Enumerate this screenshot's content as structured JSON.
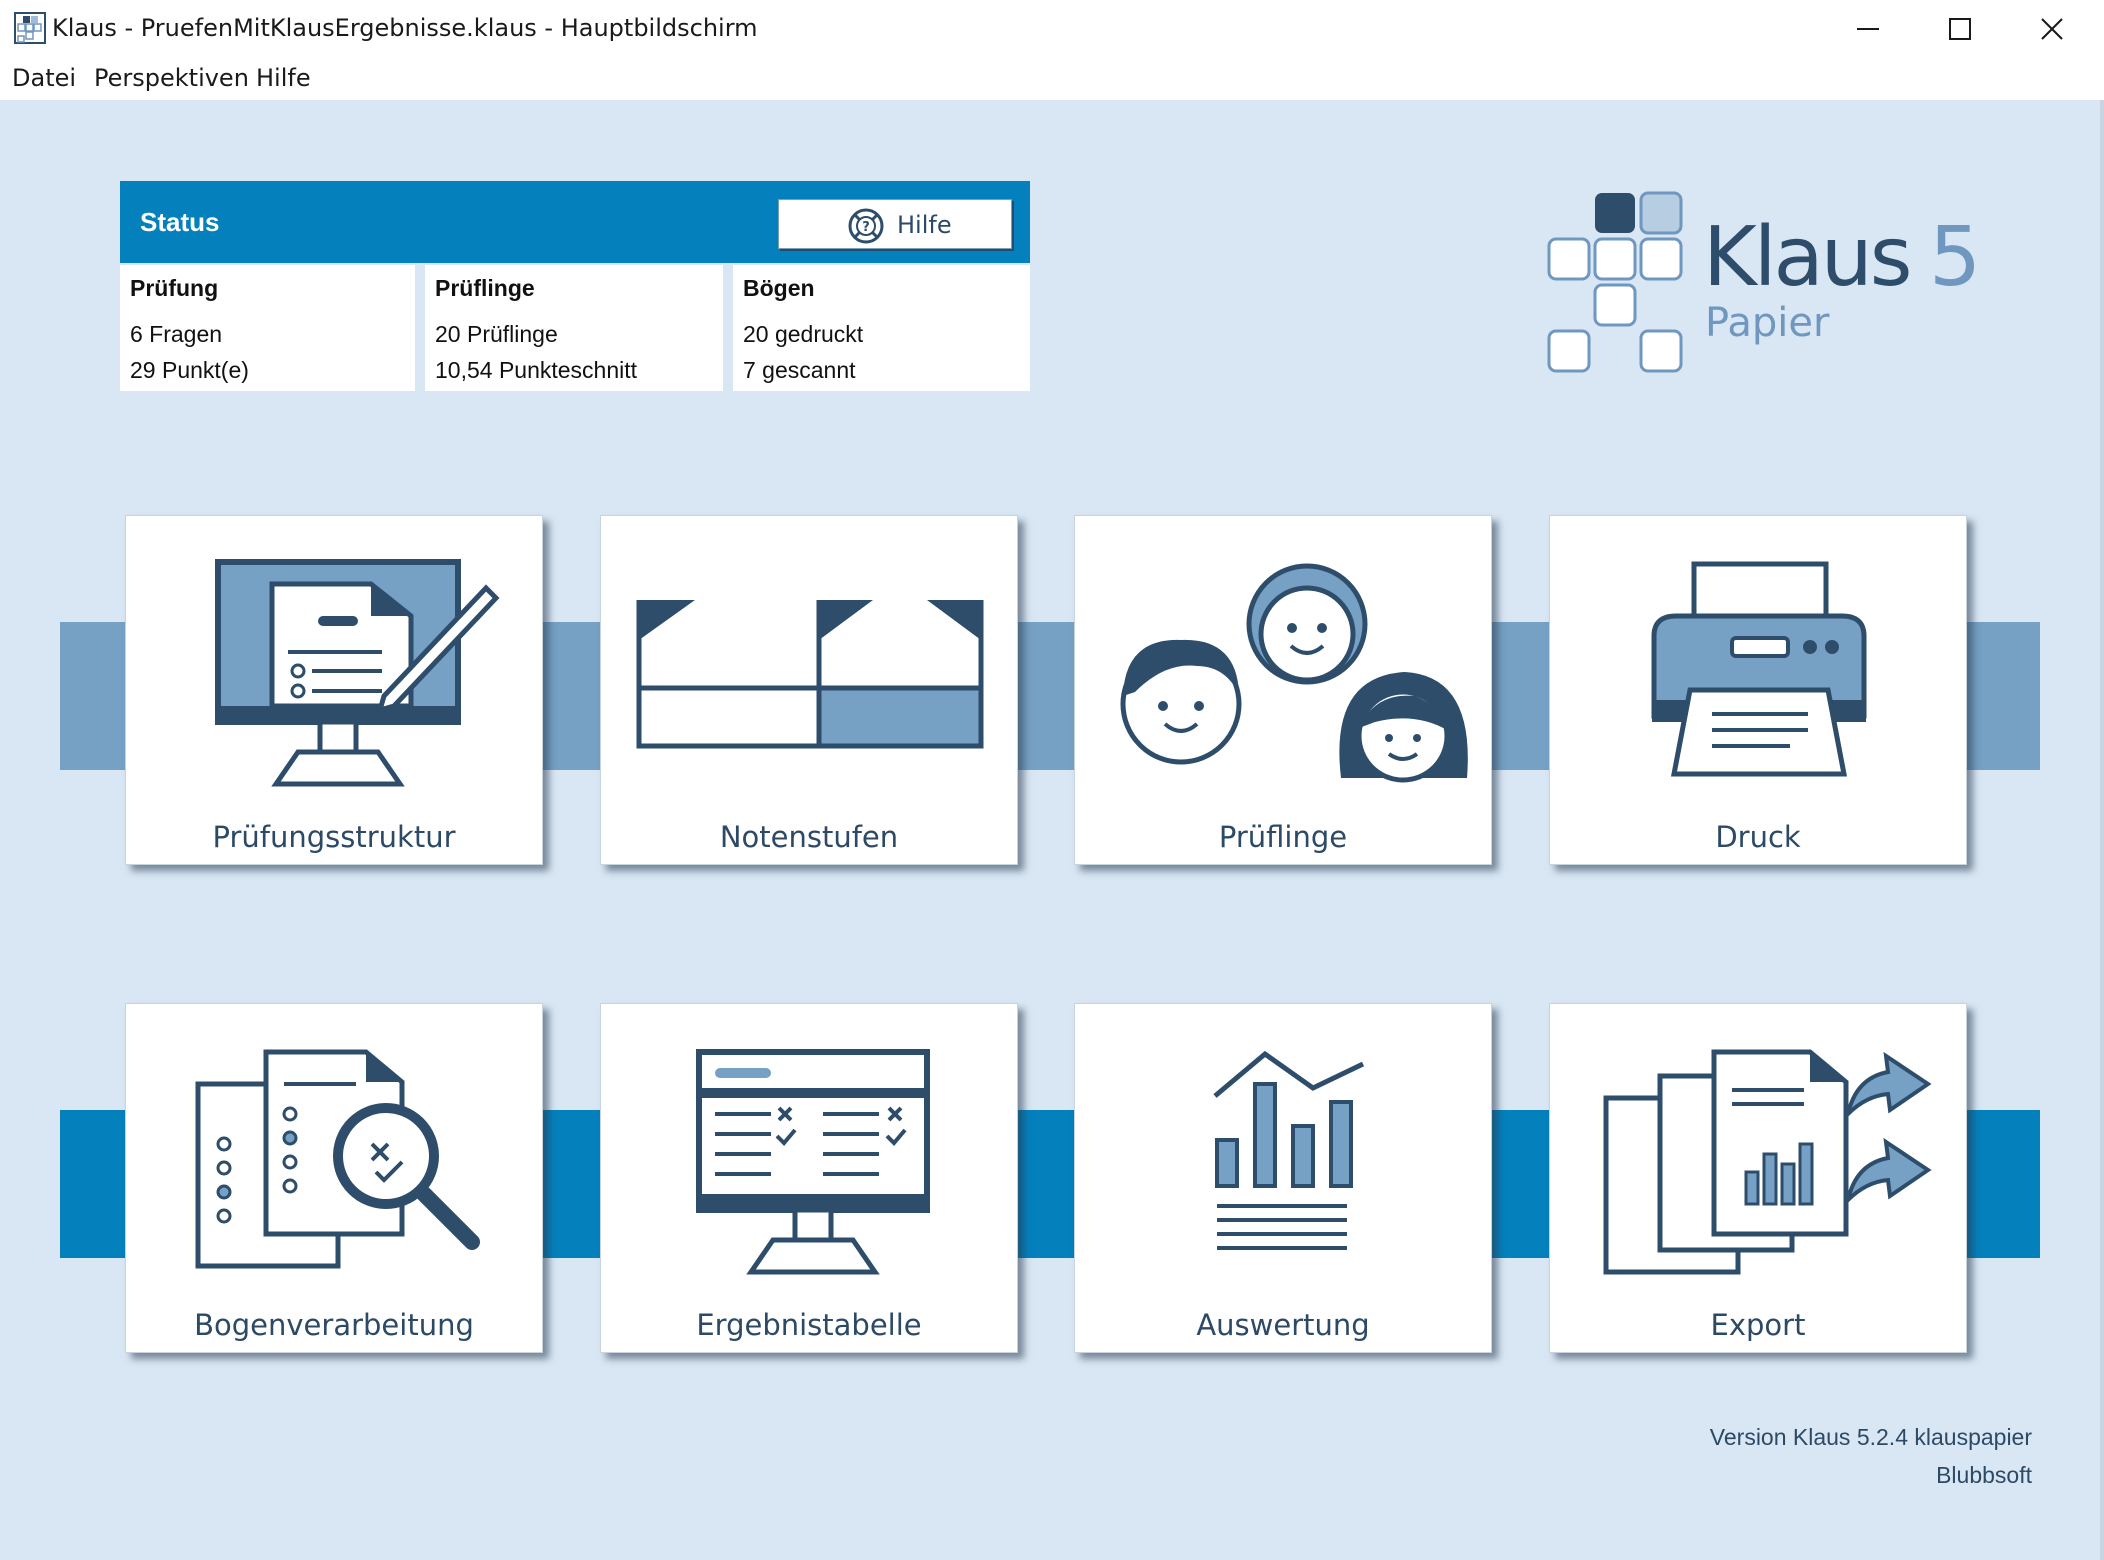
{
  "window": {
    "title": "Klaus - PruefenMitKlausErgebnisse.klaus - Hauptbildschirm",
    "controls": [
      "minimize",
      "maximize",
      "close"
    ]
  },
  "menu": [
    "Datei",
    "Perspektiven",
    "Hilfe"
  ],
  "status": {
    "title": "Status",
    "help_label": "Hilfe",
    "columns": [
      {
        "head": "Prüfung",
        "line1": "6 Fragen",
        "line2": "29 Punkt(e)"
      },
      {
        "head": "Prüflinge",
        "line1": "20 Prüflinge",
        "line2": "10,54 Punkteschnitt"
      },
      {
        "head": "Bögen",
        "line1": "20 gedruckt",
        "line2": "7 gescannt"
      }
    ]
  },
  "logo": {
    "word": "Klaus",
    "number": "5",
    "sub": "Papier"
  },
  "tiles": [
    {
      "label": "Prüfungsstruktur",
      "icon": "exam-structure-icon"
    },
    {
      "label": "Notenstufen",
      "icon": "grade-levels-icon"
    },
    {
      "label": "Prüflinge",
      "icon": "students-icon"
    },
    {
      "label": "Druck",
      "icon": "printer-icon"
    },
    {
      "label": "Bogenverarbeitung",
      "icon": "sheet-processing-icon"
    },
    {
      "label": "Ergebnistabelle",
      "icon": "results-table-icon"
    },
    {
      "label": "Auswertung",
      "icon": "evaluation-chart-icon"
    },
    {
      "label": "Export",
      "icon": "export-icon"
    }
  ],
  "footer": {
    "version": "Version Klaus 5.2.4 klauspapier",
    "vendor": "Blubbsoft"
  },
  "colors": {
    "accent": "#0480bd",
    "light_band": "#76a0c4",
    "background": "#d9e7f4",
    "dark": "#2d4d6b",
    "mid": "#6f97bf"
  }
}
